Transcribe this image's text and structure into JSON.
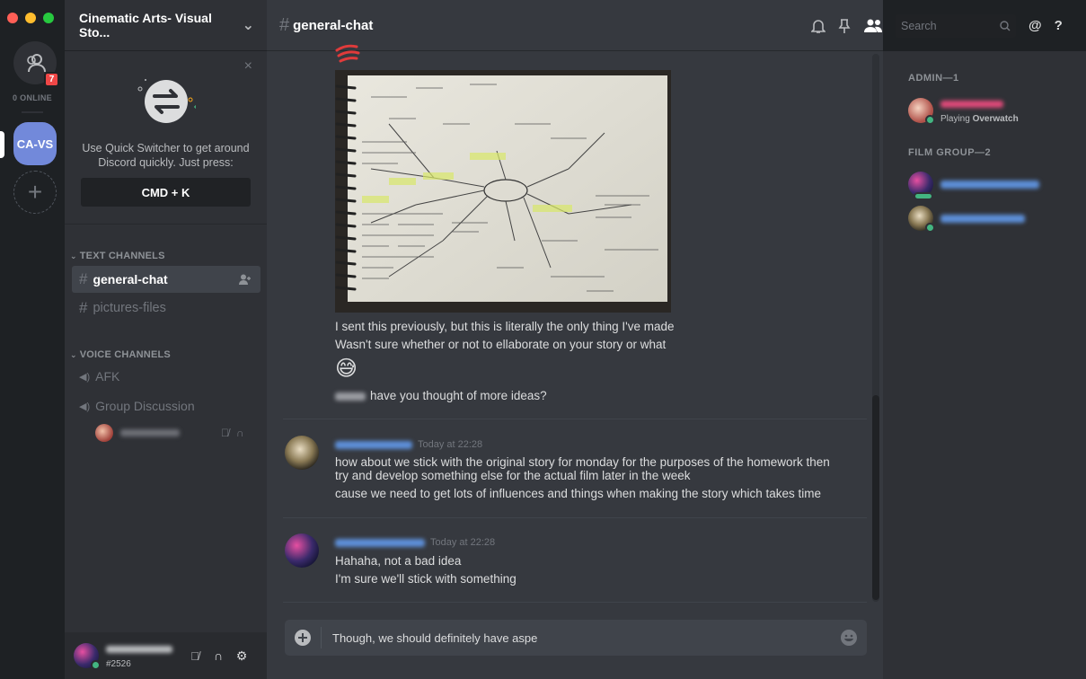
{
  "window": {
    "traffic_colors": [
      "#ff5f56",
      "#ffbd2e",
      "#27c93f"
    ]
  },
  "servers": {
    "dm_badge": "7",
    "online_label": "0 ONLINE",
    "active_server_label": "CA-VS",
    "add_server_glyph": "+"
  },
  "guild": {
    "name": "Cinematic Arts- Visual Sto...",
    "chevron": "⌄"
  },
  "quick_switcher": {
    "close": "×",
    "hint": "Use Quick Switcher to get around Discord quickly. Just press:",
    "shortcut": "CMD + K"
  },
  "sidebar": {
    "text_category": "TEXT CHANNELS",
    "text_channels": [
      {
        "name": "general-chat",
        "active": true
      },
      {
        "name": "pictures-files",
        "active": false
      }
    ],
    "voice_category": "VOICE CHANNELS",
    "voice_channels": [
      {
        "name": "AFK"
      },
      {
        "name": "Group Discussion"
      }
    ]
  },
  "user_panel": {
    "discriminator": "#2526"
  },
  "chat": {
    "channel_name": "general-chat",
    "messages": [
      {
        "lines": [
          "I sent this previously, but this is literally the only thing I've made",
          "Wasn't sure whether or not to ellaborate on your story or what"
        ],
        "emoji": "😅",
        "mention_line": "have you thought of more ideas?"
      },
      {
        "timestamp": "Today at 22:28",
        "lines": [
          "how about we stick with the original story for monday for the purposes of the homework then",
          "try and develop something else for the actual film later in the week",
          "cause we need to get lots of influences and things when making the story which takes time"
        ]
      },
      {
        "timestamp": "Today at 22:28",
        "lines": [
          "Hahaha, not a bad idea",
          "I'm sure we'll stick with something"
        ]
      }
    ],
    "composer_value": "Though, we should definitely  have aspe"
  },
  "toolbar": {
    "search_placeholder": "Search",
    "mention_glyph": "@",
    "help_glyph": "?"
  },
  "members": {
    "groups": [
      {
        "title": "ADMIN—1",
        "members": [
          {
            "activity_prefix": "Playing",
            "activity_name": "Overwatch"
          }
        ]
      },
      {
        "title": "FILM GROUP—2",
        "members": [
          {},
          {}
        ]
      }
    ]
  },
  "colors": {
    "blurple": "#7289da",
    "online": "#43b581",
    "danger": "#f04747"
  }
}
